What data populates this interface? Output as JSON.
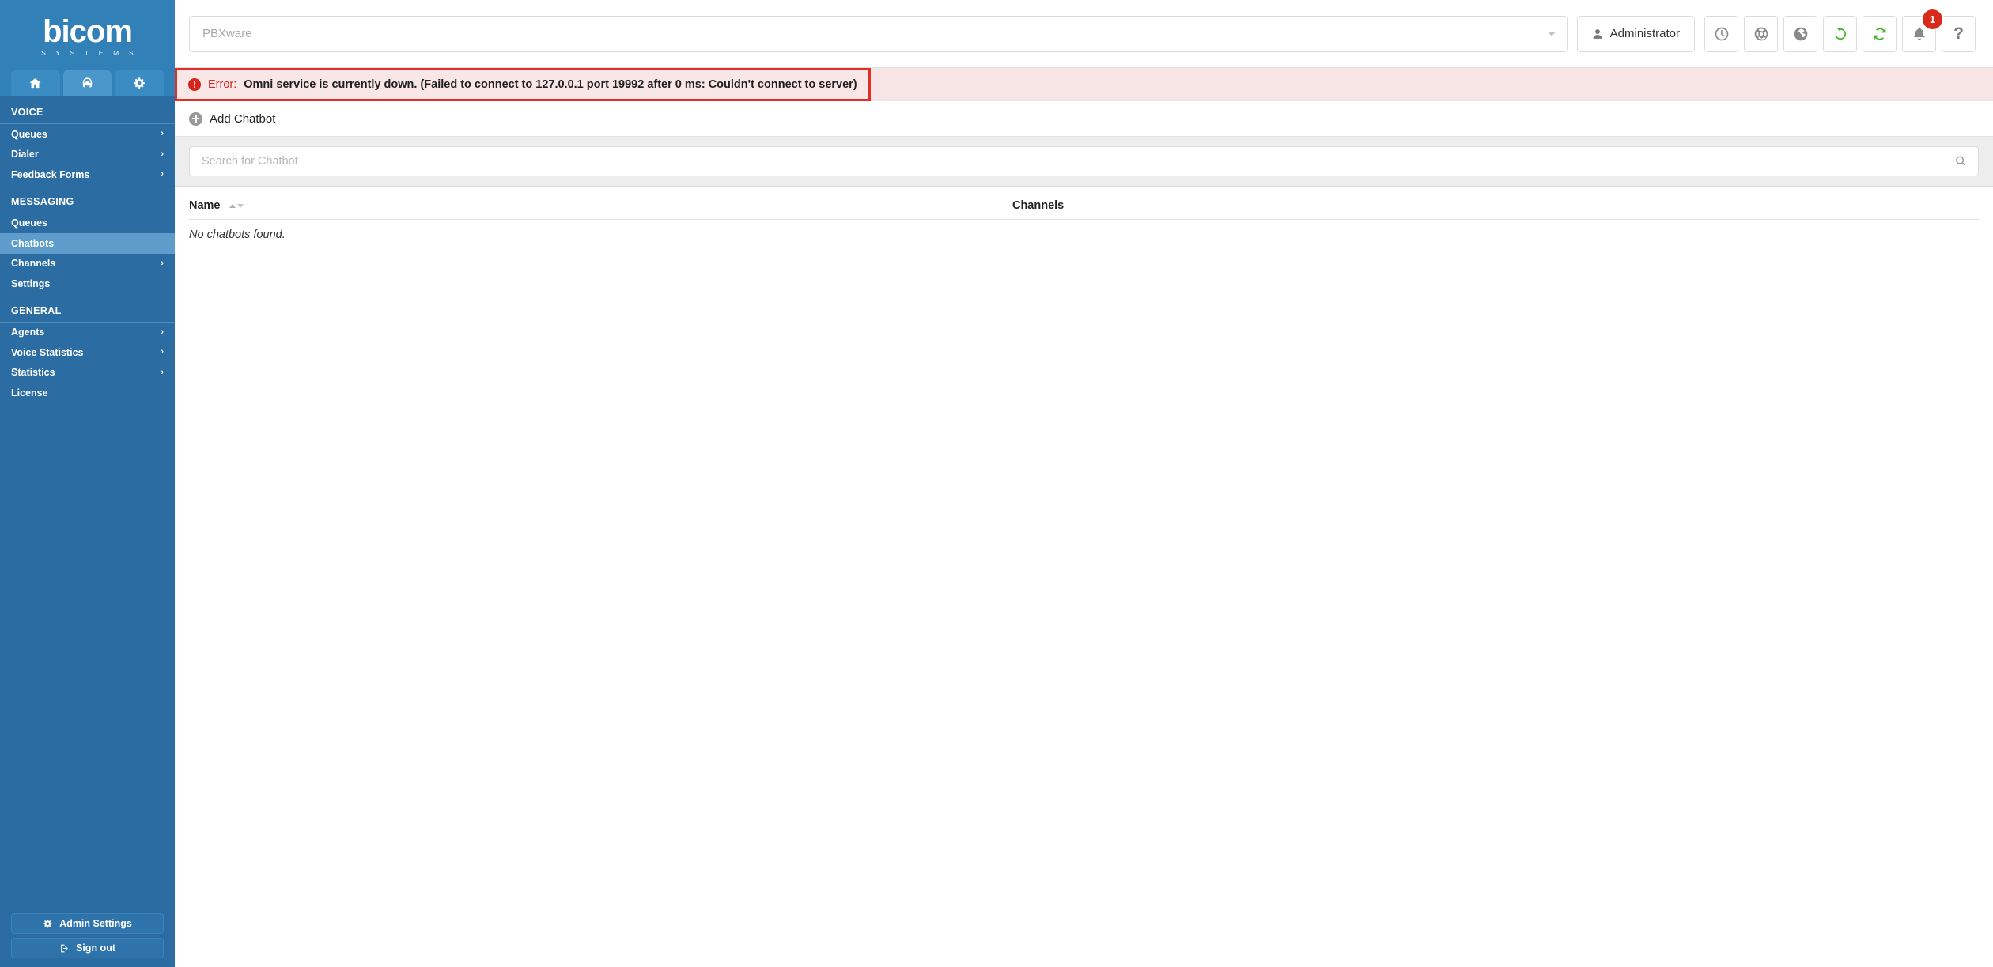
{
  "brand": {
    "name": "bicom",
    "tagline": "S Y S T E M S"
  },
  "sidebar": {
    "tabs": [
      {
        "name": "home-tab",
        "icon": "home-icon",
        "active": false
      },
      {
        "name": "voice-tab",
        "icon": "headset-icon",
        "active": true
      },
      {
        "name": "settings-tab",
        "icon": "gears-icon",
        "active": false
      }
    ],
    "sections": [
      {
        "header": "VOICE",
        "items": [
          {
            "label": "Queues",
            "expandable": true,
            "active": false
          },
          {
            "label": "Dialer",
            "expandable": true,
            "active": false
          },
          {
            "label": "Feedback Forms",
            "expandable": true,
            "active": false
          }
        ]
      },
      {
        "header": "MESSAGING",
        "items": [
          {
            "label": "Queues",
            "expandable": false,
            "active": false
          },
          {
            "label": "Chatbots",
            "expandable": false,
            "active": true
          },
          {
            "label": "Channels",
            "expandable": true,
            "active": false
          },
          {
            "label": "Settings",
            "expandable": false,
            "active": false
          }
        ]
      },
      {
        "header": "GENERAL",
        "items": [
          {
            "label": "Agents",
            "expandable": true,
            "active": false
          },
          {
            "label": "Voice Statistics",
            "expandable": true,
            "active": false
          },
          {
            "label": "Statistics",
            "expandable": true,
            "active": false
          },
          {
            "label": "License",
            "expandable": false,
            "active": false
          }
        ]
      }
    ],
    "admin_settings_label": "Admin Settings",
    "sign_out_label": "Sign out"
  },
  "topbar": {
    "server_value": "PBXware",
    "user_label": "Administrator",
    "icons": [
      {
        "name": "clock-icon",
        "glyph": "clock",
        "green": false
      },
      {
        "name": "lifebuoy-icon",
        "glyph": "lifebuoy",
        "green": false
      },
      {
        "name": "globe-icon",
        "glyph": "globe",
        "green": false
      },
      {
        "name": "reload-icon",
        "glyph": "reload",
        "green": true
      },
      {
        "name": "sync-icon",
        "glyph": "sync",
        "green": true
      }
    ],
    "notification_count": "1",
    "help_label": "?"
  },
  "alert": {
    "label": "Error:",
    "message": "Omni service is currently down. (Failed to connect to 127.0.0.1 port 19992 after 0 ms: Couldn't connect to server)"
  },
  "actions": {
    "add_chatbot_label": "Add Chatbot"
  },
  "search": {
    "placeholder": "Search for Chatbot",
    "value": ""
  },
  "table": {
    "columns": [
      {
        "label": "Name",
        "sortable": true
      },
      {
        "label": "Channels",
        "sortable": false
      }
    ],
    "rows": [],
    "empty_message": "No chatbots found."
  },
  "colors": {
    "sidebar_bg": "#2b6ca3",
    "sidebar_header_bg": "#3180b8",
    "active_item": "#5e9dcb",
    "error_border": "#e02f23",
    "error_bg": "#f7e4e5",
    "error_text": "#d6261b",
    "badge": "#d9291c",
    "accent_green": "#3cb521"
  }
}
